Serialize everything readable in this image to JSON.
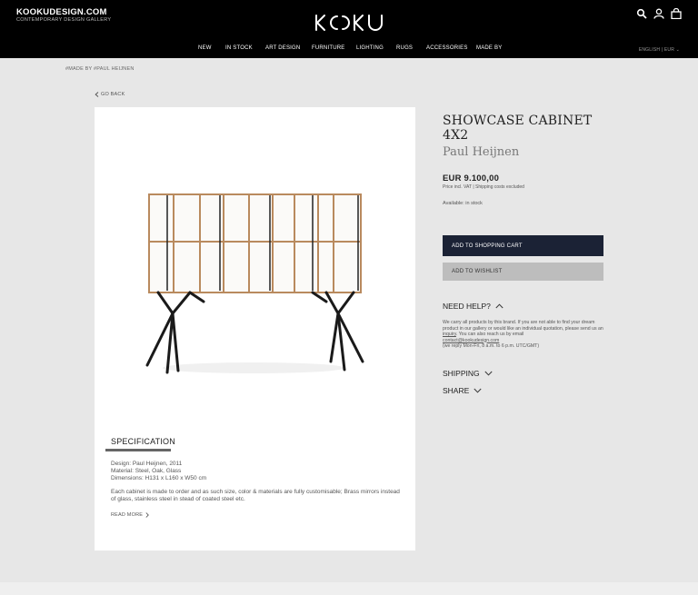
{
  "brand": {
    "name": "KOOKUDESIGN.COM",
    "tagline": "CONTEMPORARY DESIGN GALLERY"
  },
  "logo": {
    "text": "KOOKU"
  },
  "header_icons": [
    "search-icon",
    "user-icon",
    "bag-icon"
  ],
  "nav": {
    "items": [
      "NEW",
      "IN STOCK",
      "ART DESIGN",
      "FURNITURE",
      "LIGHTING",
      "RUGS",
      "ACCESSORIES",
      "MADE BY"
    ],
    "locale": "ENGLISH  |  EUR ⌄"
  },
  "breadcrumb": "#MADE BY  #PAUL HEIJNEN",
  "go_back": "GO BACK",
  "product": {
    "title": "SHOWCASE CABINET 4X2",
    "designer": "Paul Heijnen",
    "price": "EUR 9.100,00",
    "price_note": "Price incl. VAT  |  Shipping costs excluded",
    "availability": "Available: in stock",
    "add_to_cart": "ADD TO SHOPPING CART",
    "add_to_wishlist": "ADD TO WISHLIST"
  },
  "specification": {
    "tab_label": "SPECIFICATION",
    "design": "Design: Paul Heijnen, 2011",
    "material": "Material: Steel, Oak, Glass",
    "dimensions": "Dimensions: H131 x L160 x W50 cm",
    "description": "Each cabinet is made to order and as such size, color & materials are fully customisable; Brass mirrors instead of glass, stainless steel in stead of coated steel etc.",
    "read_more": "READ MORE"
  },
  "help": {
    "title": "NEED HELP?",
    "text_1": "We carry all products by this brand. If you are not able to find your dream product in our gallery or would like an individual quotation, please send us an",
    "inquiry_link": "inquiry",
    "text_2": ". You can also reach us by email",
    "email": "contact@kookudesign.com",
    "hours": "(we reply Mon-Fri, 8 a.m. to 6 p.m. UTC/GMT)"
  },
  "accordions": {
    "shipping": "SHIPPING",
    "share": "SHARE"
  },
  "colors": {
    "header_bg": "#000000",
    "cart_button": "#1b2235",
    "wishlist_button": "#bdbdbd",
    "page_bg": "#e7e7e7"
  }
}
